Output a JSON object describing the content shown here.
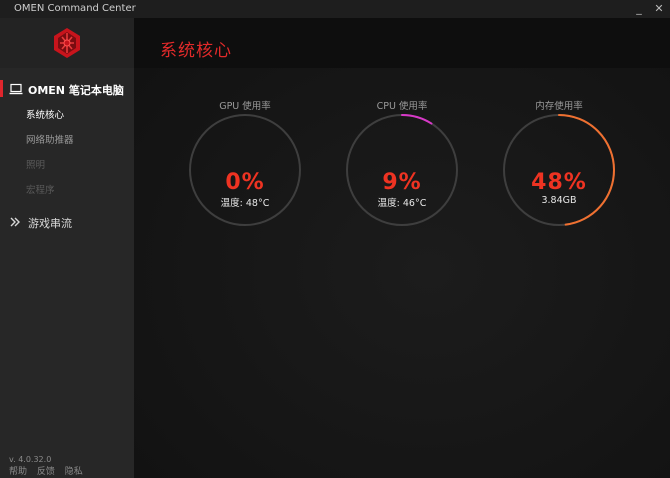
{
  "window": {
    "title": "OMEN Command Center",
    "minimize_glyph": "_",
    "close_glyph": "✕"
  },
  "sidebar": {
    "groups": [
      {
        "label": "OMEN 笔记本电脑",
        "icon": "laptop-icon",
        "items": [
          {
            "label": "系统核心",
            "state": "active"
          },
          {
            "label": "网络助推器",
            "state": "normal"
          },
          {
            "label": "照明",
            "state": "dim"
          },
          {
            "label": "宏程序",
            "state": "dim"
          }
        ]
      },
      {
        "label": "游戏串流",
        "icon": "streaming-icon",
        "items": []
      }
    ],
    "version": "v. 4.0.32.0",
    "footer_links": [
      "帮助",
      "反馈",
      "隐私"
    ]
  },
  "main": {
    "title": "系统核心",
    "gauges": [
      {
        "label": "GPU 使用率",
        "value_text": "0%",
        "fraction": 0.0,
        "subtext": "温度: 48°C"
      },
      {
        "label": "CPU 使用率",
        "value_text": "9%",
        "fraction": 0.09,
        "subtext": "温度: 46°C"
      },
      {
        "label": "内存使用率",
        "value_text": "48%",
        "fraction": 0.48,
        "subtext": "3.84GB"
      }
    ]
  },
  "colors": {
    "accent_red": "#e0262d",
    "cpu_arc": "#d838c8",
    "mem_arc": "#f07030",
    "ring_track": "#3e3e3e"
  }
}
